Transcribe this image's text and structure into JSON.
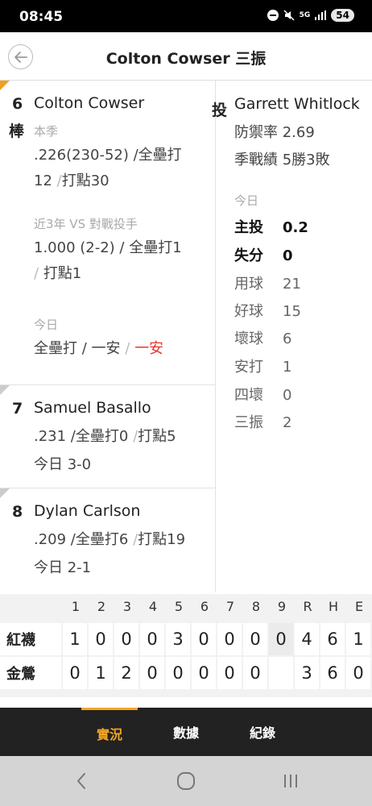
{
  "status_bar": {
    "time": "08:45",
    "network": "5G",
    "battery": "54"
  },
  "header": {
    "title": "Colton Cowser 三振"
  },
  "batters": [
    {
      "order": "6",
      "position": "棒",
      "name": "Colton Cowser",
      "season_label": "本季",
      "season_stat_a": ".226(230-52) /全壘打",
      "season_stat_b": "12",
      "season_stat_c": "/",
      "season_stat_d": "打點30",
      "vs_label": "近3年 VS 對戰投手",
      "vs_stat_a": "1.000 (2-2) / 全壘打1",
      "vs_stat_b": "/",
      "vs_stat_c": "打點1",
      "today_label": "今日",
      "today_a": "全壘打 / 一安",
      "today_b": "/",
      "today_c": "一安"
    },
    {
      "order": "7",
      "name": "Samuel Basallo",
      "stat_a": ".231 /全壘打0",
      "stat_b": "/",
      "stat_c": "打點5",
      "today": "今日 3-0"
    },
    {
      "order": "8",
      "name": "Dylan Carlson",
      "stat_a": ".209 /全壘打6",
      "stat_b": "/",
      "stat_c": "打點19",
      "today": "今日 2-1"
    }
  ],
  "pitcher": {
    "position": "投",
    "name": "Garrett Whitlock",
    "era": "防禦率 2.69",
    "record": "季戰績 5勝3敗",
    "today_label": "今日",
    "stats": [
      {
        "key": "主投",
        "value": "0.2"
      },
      {
        "key": "失分",
        "value": "0"
      },
      {
        "key": "用球",
        "value": "21"
      },
      {
        "key": "好球",
        "value": "15"
      },
      {
        "key": "壞球",
        "value": "6"
      },
      {
        "key": "安打",
        "value": "1"
      },
      {
        "key": "四壞",
        "value": "0"
      },
      {
        "key": "三振",
        "value": "2"
      }
    ]
  },
  "scoreboard": {
    "headers": [
      "1",
      "2",
      "3",
      "4",
      "5",
      "6",
      "7",
      "8",
      "9",
      "R",
      "H",
      "E"
    ],
    "teams": [
      {
        "name": "紅襪",
        "scores": [
          "1",
          "0",
          "0",
          "0",
          "3",
          "0",
          "0",
          "0",
          "0",
          "4",
          "6",
          "1"
        ]
      },
      {
        "name": "金鶯",
        "scores": [
          "0",
          "1",
          "2",
          "0",
          "0",
          "0",
          "0",
          "0",
          "",
          "3",
          "6",
          "0"
        ]
      }
    ]
  },
  "tabs": [
    {
      "label": "實況",
      "active": true
    },
    {
      "label": "數據",
      "active": false
    },
    {
      "label": "紀錄",
      "active": false
    }
  ],
  "colors": {
    "accent": "#f5a623",
    "hit_red": "#e5372c",
    "tab_bg": "#222222"
  }
}
